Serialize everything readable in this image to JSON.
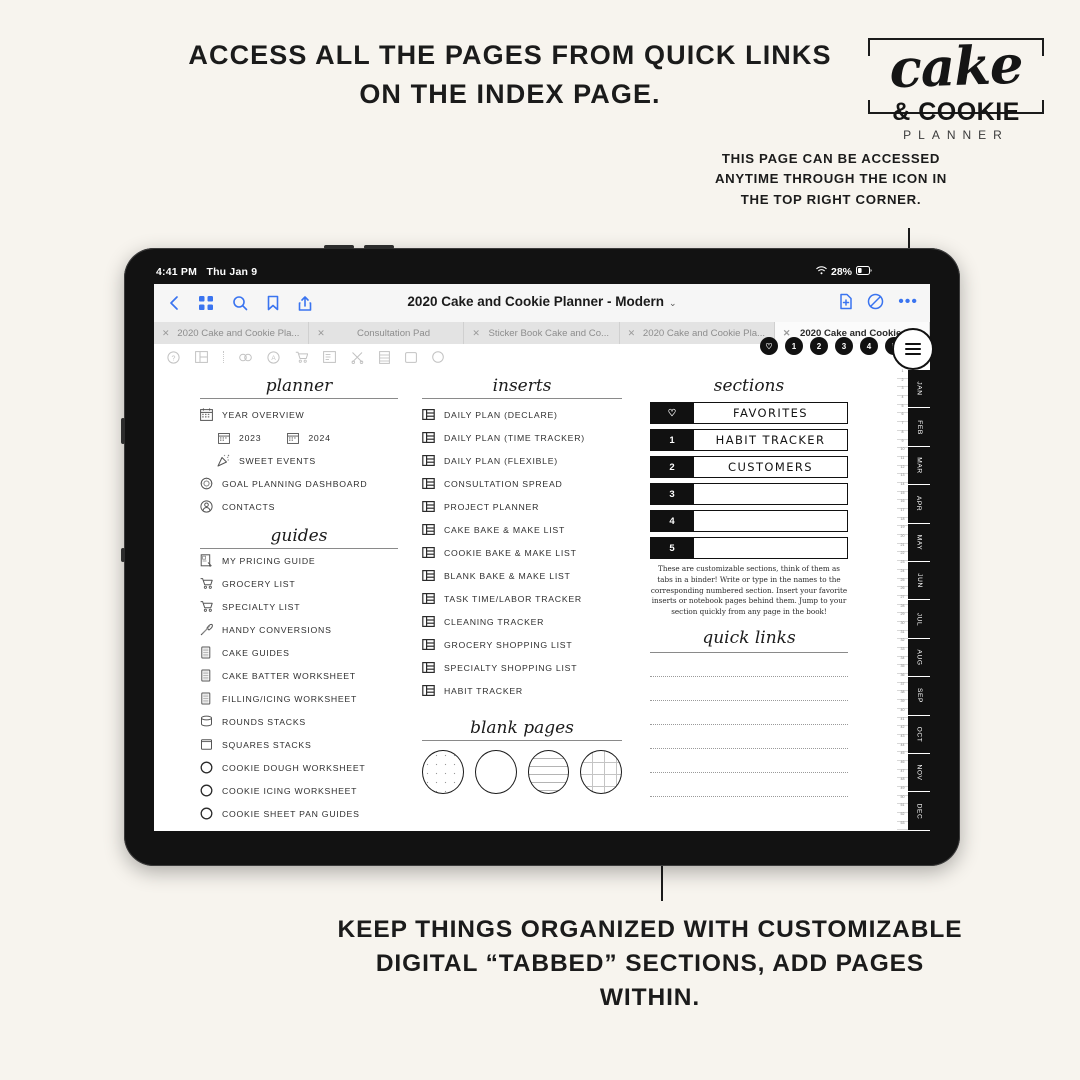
{
  "headline": "ACCESS ALL THE PAGES FROM QUICK LINKS ON THE INDEX PAGE.",
  "logo": {
    "cake": "cake",
    "cookie": "& COOKIE",
    "planner": "PLANNER"
  },
  "callout_top": "THIS PAGE CAN BE ACCESSED ANYTIME THROUGH THE ICON IN THE TOP RIGHT CORNER.",
  "callout_bottom": "KEEP THINGS ORGANIZED WITH CUSTOMIZABLE DIGITAL “TABBED” SECTIONS, ADD PAGES WITHIN.",
  "status_bar": {
    "time": "4:41 PM",
    "date": "Thu Jan 9",
    "battery": "28%",
    "wifi_icon": "wifi-icon"
  },
  "app_bar": {
    "title": "2020 Cake and Cookie Planner - Modern",
    "chevron": "⌄",
    "left_icons": [
      "back-chevron-icon",
      "grid-icon",
      "search-icon",
      "bookmark-icon",
      "share-icon"
    ],
    "right_icons": [
      "add-page-icon",
      "eraser-icon",
      "more-icon"
    ],
    "more_glyph": "•••"
  },
  "tabs": [
    {
      "label": "2020 Cake and Cookie Pla...",
      "active": false
    },
    {
      "label": "Consultation Pad",
      "active": false
    },
    {
      "label": "Sticker Book Cake and Co...",
      "active": false
    },
    {
      "label": "2020 Cake and Cookie Pla...",
      "active": false
    },
    {
      "label": "2020 Cake and Cookie Pla",
      "active": true
    }
  ],
  "tool_row": [
    "help-icon",
    "layout-icon",
    "divider",
    "pen-icon",
    "stamp-icon",
    "cart-icon",
    "note-icon",
    "scissors-icon",
    "list-icon",
    "square-icon",
    "circle-icon"
  ],
  "planner": {
    "heading": "planner",
    "items": [
      {
        "label": "YEAR OVERVIEW",
        "icon": "calendar-icon",
        "indent": 0
      },
      {
        "label": "2023",
        "icon": "calendar-icon",
        "indent": 1,
        "inline2_label": "2024",
        "inline2_icon": "calendar-icon"
      },
      {
        "label": "SWEET EVENTS",
        "icon": "confetti-icon",
        "indent": 1
      },
      {
        "label": "GOAL PLANNING DASHBOARD",
        "icon": "wreath-icon",
        "indent": 0
      },
      {
        "label": "CONTACTS",
        "icon": "contact-icon",
        "indent": 0
      }
    ]
  },
  "guides": {
    "heading": "guides",
    "items": [
      {
        "label": "MY PRICING GUIDE",
        "icon": "price-tag-icon"
      },
      {
        "label": "GROCERY LIST",
        "icon": "cart-icon"
      },
      {
        "label": "SPECIALTY LIST",
        "icon": "cart-icon"
      },
      {
        "label": "HANDY CONVERSIONS",
        "icon": "whisk-icon"
      },
      {
        "label": "CAKE GUIDES",
        "icon": "cake-layers-icon"
      },
      {
        "label": "CAKE BATTER WORKSHEET",
        "icon": "cake-layers-icon"
      },
      {
        "label": "FILLING/ICING WORKSHEET",
        "icon": "cake-layers-icon"
      },
      {
        "label": "ROUNDS STACKS",
        "icon": "cylinder-icon"
      },
      {
        "label": "SQUARES STACKS",
        "icon": "square-icon"
      },
      {
        "label": "COOKIE DOUGH WORKSHEET",
        "icon": "circle-icon"
      },
      {
        "label": "COOKIE ICING WORKSHEET",
        "icon": "circle-icon"
      },
      {
        "label": "COOKIE SHEET PAN GUIDES",
        "icon": "circle-icon"
      }
    ]
  },
  "inserts": {
    "heading": "inserts",
    "items": [
      {
        "label": "DAILY PLAN (DECLARE)",
        "icon": "page-layout-icon"
      },
      {
        "label": "DAILY PLAN (TIME TRACKER)",
        "icon": "page-layout-icon"
      },
      {
        "label": "DAILY PLAN (FLEXIBLE)",
        "icon": "page-layout-icon"
      },
      {
        "label": "CONSULTATION SPREAD",
        "icon": "page-layout-icon"
      },
      {
        "label": "PROJECT PLANNER",
        "icon": "page-layout-icon"
      },
      {
        "label": "CAKE BAKE & MAKE LIST",
        "icon": "page-layout-icon"
      },
      {
        "label": "COOKIE BAKE & MAKE LIST",
        "icon": "page-layout-icon"
      },
      {
        "label": "BLANK BAKE & MAKE LIST",
        "icon": "page-layout-icon"
      },
      {
        "label": "TASK TIME/LABOR TRACKER",
        "icon": "page-layout-icon"
      },
      {
        "label": "CLEANING TRACKER",
        "icon": "page-layout-icon"
      },
      {
        "label": "GROCERY SHOPPING LIST",
        "icon": "page-layout-icon"
      },
      {
        "label": "SPECIALTY SHOPPING LIST",
        "icon": "page-layout-icon"
      },
      {
        "label": "HABIT TRACKER",
        "icon": "page-layout-icon"
      }
    ]
  },
  "blank_pages": {
    "heading": "blank pages",
    "styles": [
      "dotted",
      "plain",
      "lined",
      "grid"
    ]
  },
  "sections": {
    "heading": "sections",
    "rows": [
      {
        "num": "♡",
        "name": "FAVORITES"
      },
      {
        "num": "1",
        "name": "HABIT TRACKER"
      },
      {
        "num": "2",
        "name": "CUSTOMERS"
      },
      {
        "num": "3",
        "name": ""
      },
      {
        "num": "4",
        "name": ""
      },
      {
        "num": "5",
        "name": ""
      }
    ],
    "note": "These are customizable sections, think of them as tabs in a binder! Write or type in the names to the corresponding numbered section. Insert your favorite inserts or notebook pages behind them. Jump to your section quickly from any page in the book!"
  },
  "quick_links": {
    "heading": "quick links",
    "line_count": 6
  },
  "month_tabs": [
    "JAN",
    "FEB",
    "MAR",
    "APR",
    "MAY",
    "JUN",
    "JUL",
    "AUG",
    "SEP",
    "OCT",
    "NOV",
    "DEC"
  ],
  "floating_dots": [
    "♡",
    "1",
    "2",
    "3",
    "4",
    "5"
  ],
  "menu_button": "hamburger-menu-icon"
}
